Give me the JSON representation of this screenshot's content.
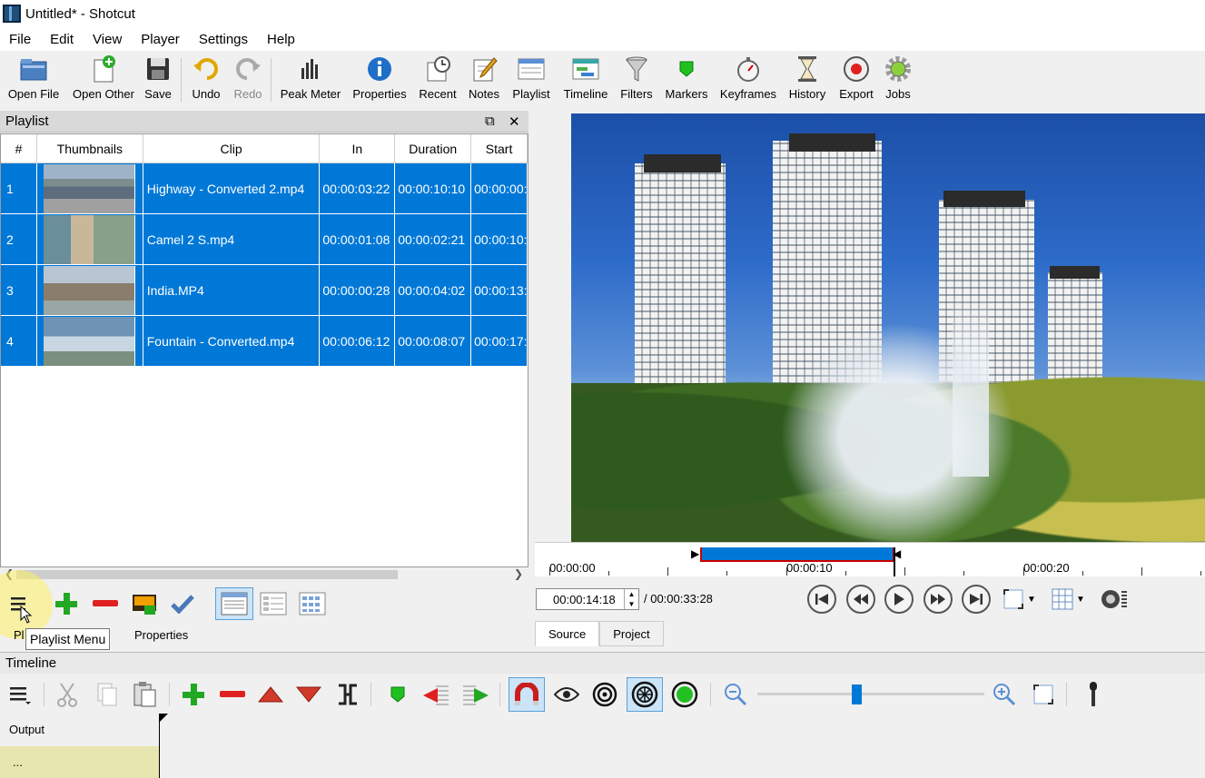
{
  "window": {
    "title": "Untitled* - Shotcut"
  },
  "menu": [
    "File",
    "Edit",
    "View",
    "Player",
    "Settings",
    "Help"
  ],
  "toolbar": {
    "open_file": "Open File",
    "open_other": "Open Other",
    "save": "Save",
    "undo": "Undo",
    "redo": "Redo",
    "peak_meter": "Peak Meter",
    "properties": "Properties",
    "recent": "Recent",
    "notes": "Notes",
    "playlist": "Playlist",
    "timeline": "Timeline",
    "filters": "Filters",
    "markers": "Markers",
    "keyframes": "Keyframes",
    "history": "History",
    "export": "Export",
    "jobs": "Jobs"
  },
  "playlist": {
    "title": "Playlist",
    "columns": [
      "#",
      "Thumbnails",
      "Clip",
      "In",
      "Duration",
      "Start"
    ],
    "rows": [
      {
        "num": "1",
        "clip": "Highway - Converted 2.mp4",
        "in": "00:00:03:22",
        "duration": "00:00:10:10",
        "start": "00:00:00:"
      },
      {
        "num": "2",
        "clip": "Camel 2 S.mp4",
        "in": "00:00:01:08",
        "duration": "00:00:02:21",
        "start": "00:00:10:"
      },
      {
        "num": "3",
        "clip": "India.MP4",
        "in": "00:00:00:28",
        "duration": "00:00:04:02",
        "start": "00:00:13:"
      },
      {
        "num": "4",
        "clip": "Fountain - Converted.mp4",
        "in": "00:00:06:12",
        "duration": "00:00:08:07",
        "start": "00:00:17:"
      }
    ],
    "tab_playlist_partial": "Pl",
    "tab_properties": "Properties",
    "tooltip": "Playlist Menu"
  },
  "player": {
    "ruler_labels": [
      "00:00:00",
      "00:00:10",
      "00:00:20"
    ],
    "timecode": "00:00:14:18",
    "duration": "/ 00:00:33:28",
    "tabs": [
      "Source",
      "Project"
    ]
  },
  "timeline": {
    "title": "Timeline",
    "output_label": "Output",
    "track_label": "..."
  },
  "colors": {
    "selection": "#0078d7",
    "accent_green": "#22a822",
    "accent_red": "#e02020"
  }
}
